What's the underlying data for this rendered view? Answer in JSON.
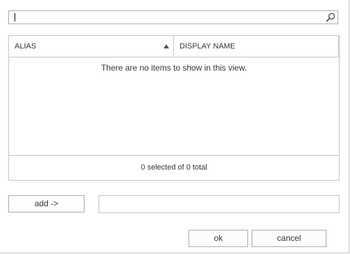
{
  "search": {
    "value": "",
    "placeholder": ""
  },
  "grid": {
    "columns": [
      {
        "label": "ALIAS",
        "sorted": "ascending"
      },
      {
        "label": "DISPLAY NAME"
      }
    ],
    "rows": [],
    "empty_message": "There are no items to show in this view.",
    "footer_status": "0 selected of 0 total"
  },
  "actions": {
    "add_label": "add ->",
    "selected_value": ""
  },
  "buttons": {
    "ok_label": "ok",
    "cancel_label": "cancel"
  },
  "icons": {
    "search": "search-icon",
    "sort": "sort-ascending-icon"
  },
  "colors": {
    "border": "#c6c6c6",
    "button_border": "#ababab",
    "text": "#333333"
  }
}
